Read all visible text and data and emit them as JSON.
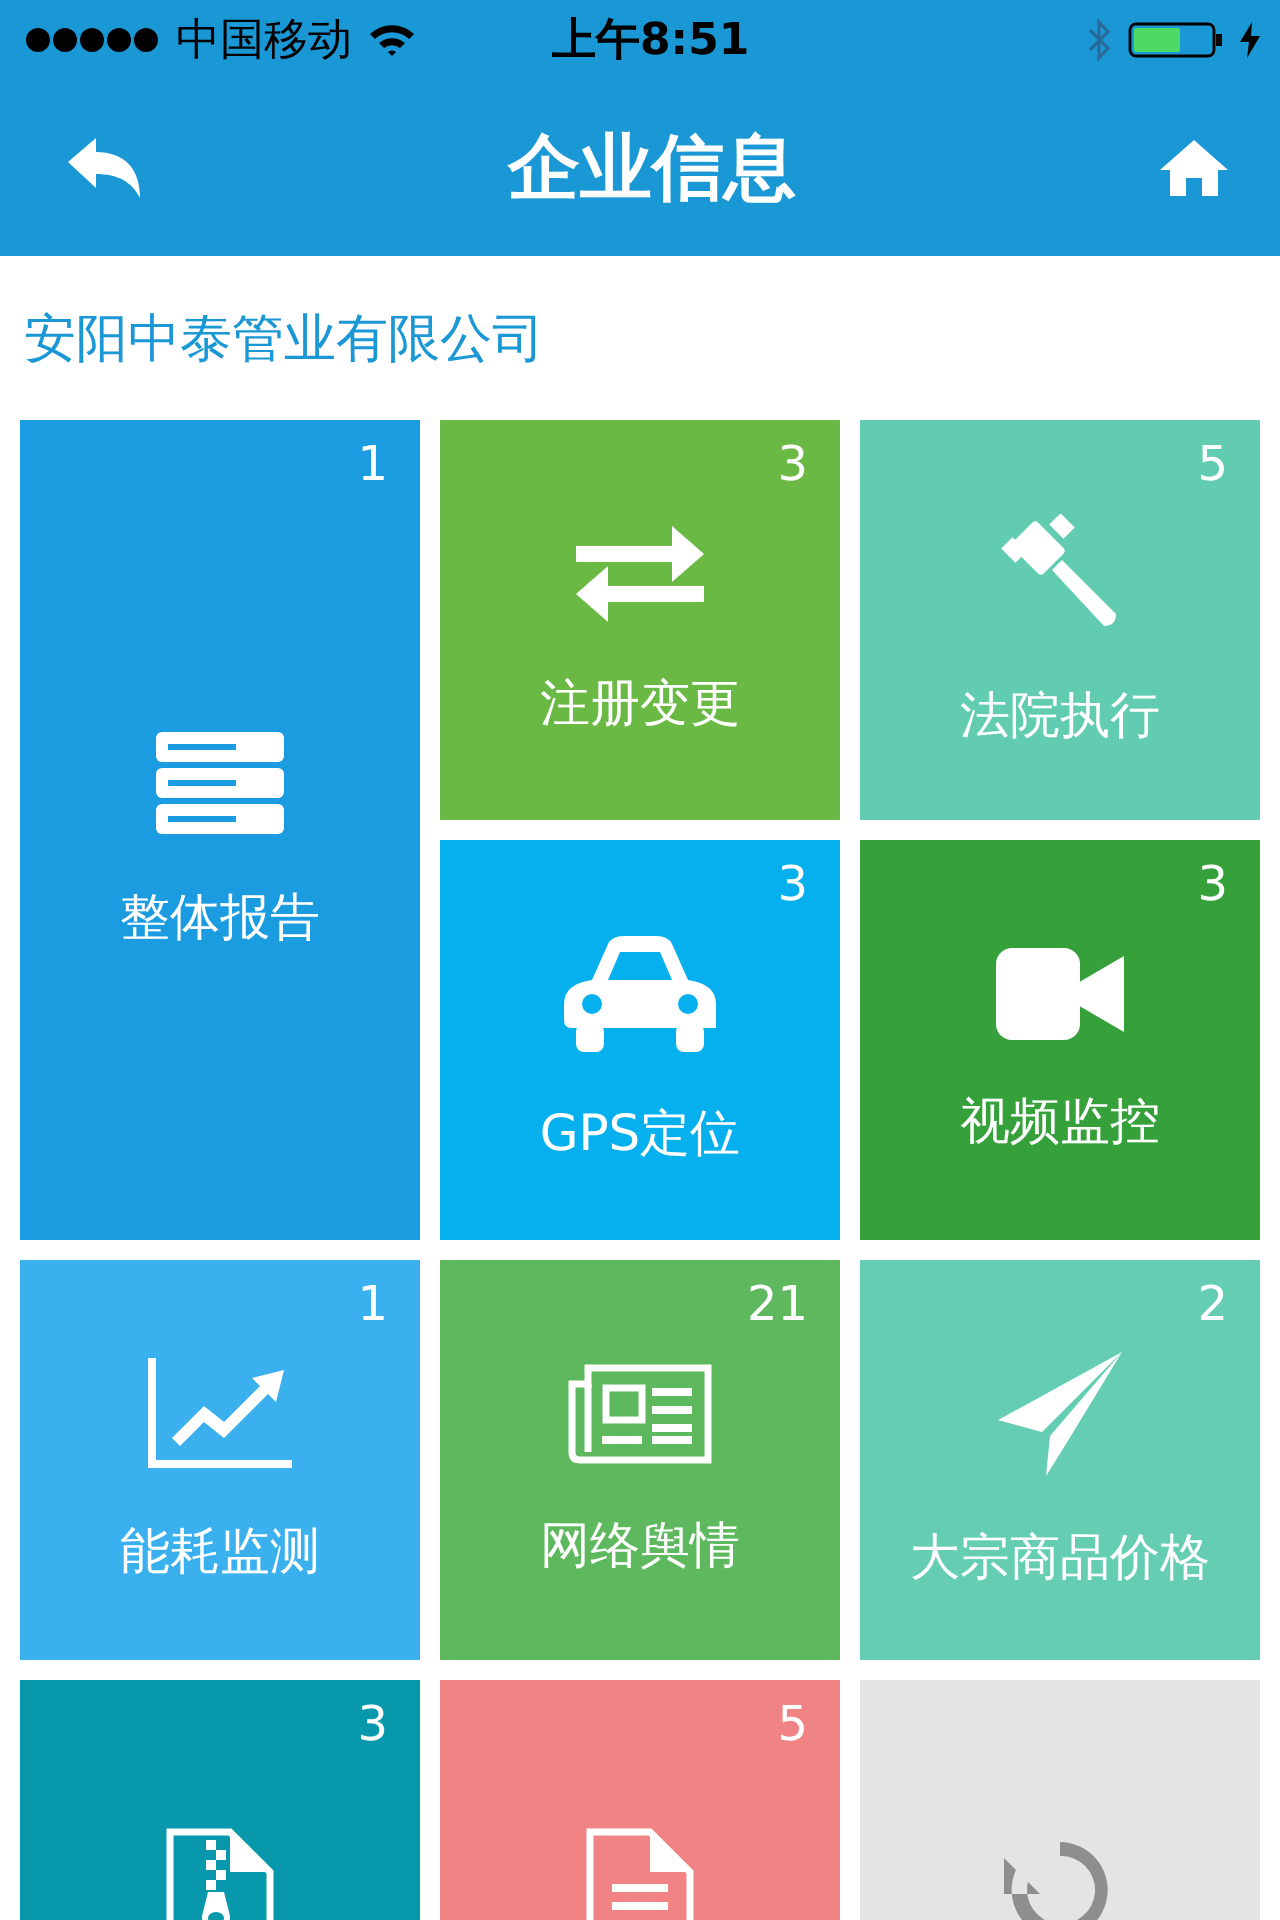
{
  "status_bar": {
    "carrier": "中国移动",
    "time": "上午8:51"
  },
  "nav_bar": {
    "title": "企业信息"
  },
  "company": "安阳中泰管业有限公司",
  "tiles": [
    {
      "label": "整体报告",
      "count": "1",
      "color": "#1b9ce0"
    },
    {
      "label": "注册变更",
      "count": "3",
      "color": "#6ab944"
    },
    {
      "label": "法院执行",
      "count": "5",
      "color": "#62ccb1"
    },
    {
      "label": "GPS定位",
      "count": "3",
      "color": "#06b0ef"
    },
    {
      "label": "视频监控",
      "count": "3",
      "color": "#36a03a"
    },
    {
      "label": "能耗监测",
      "count": "1",
      "color": "#3ab0ee"
    },
    {
      "label": "网络舆情",
      "count": "21",
      "color": "#5db85e"
    },
    {
      "label": "大宗商品价格",
      "count": "2",
      "color": "#64cdb2"
    },
    {
      "count": "3",
      "color": "#0799ab"
    },
    {
      "count": "5",
      "color": "#f08383"
    },
    {
      "color": "#e4e4e4"
    }
  ]
}
